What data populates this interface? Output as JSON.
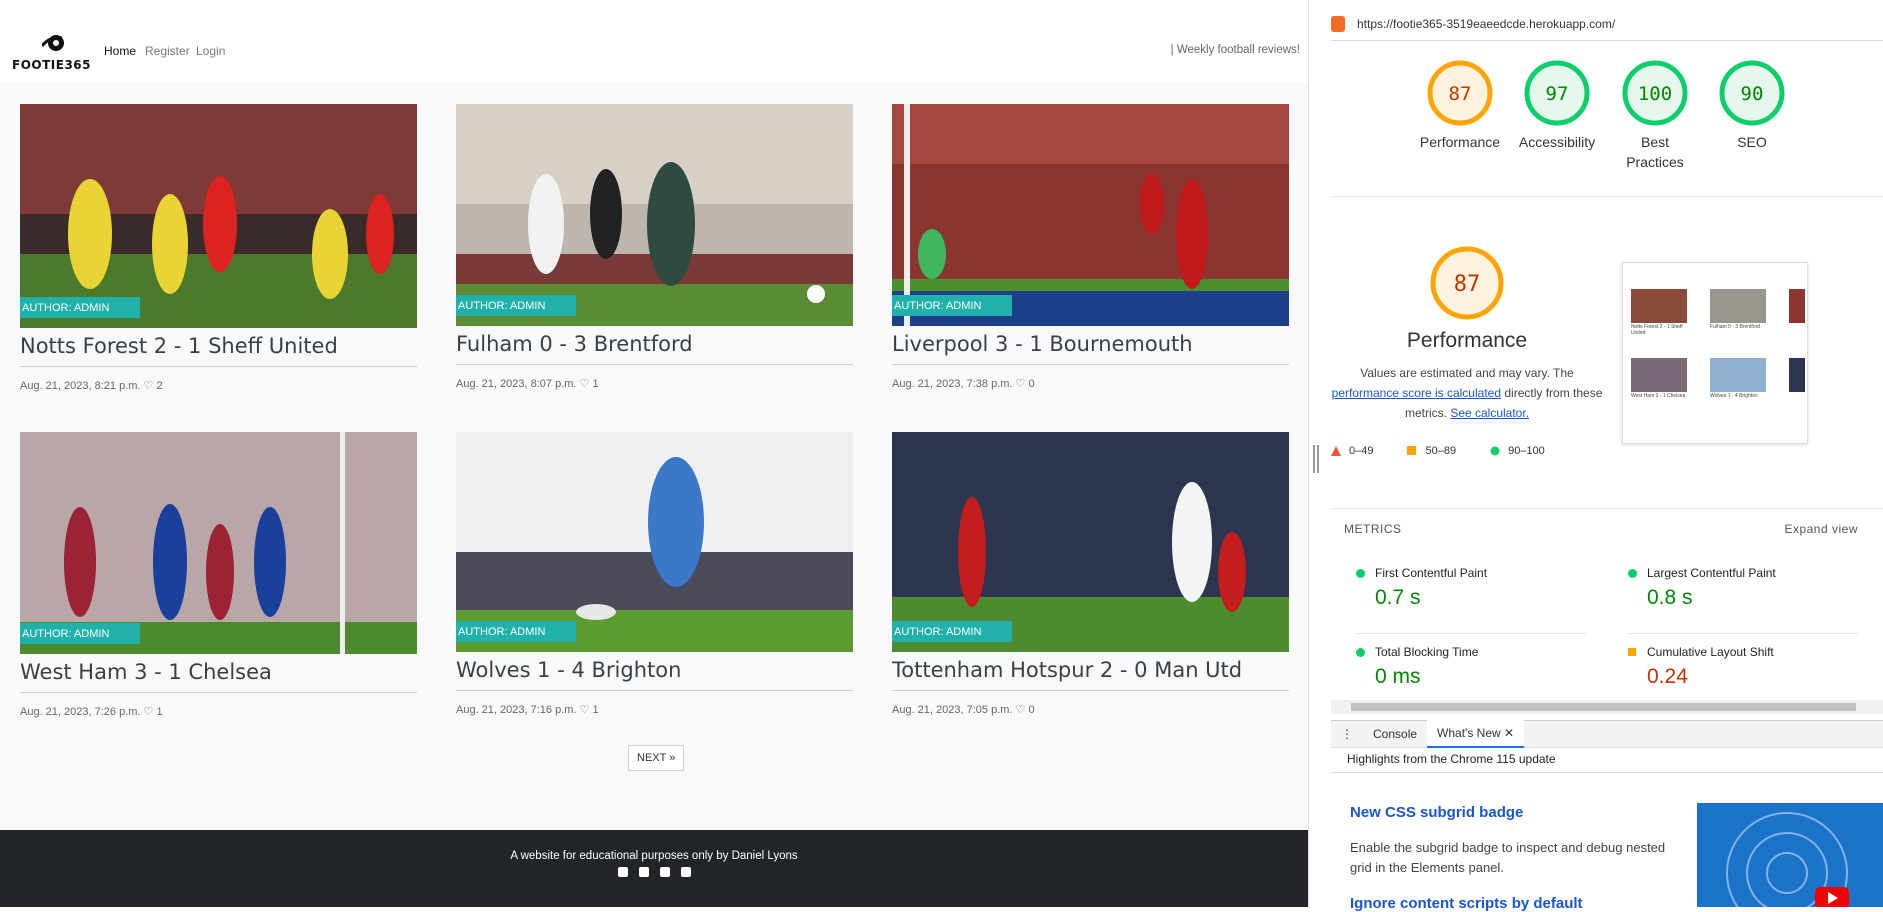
{
  "site": {
    "brand": "FOOTIE365",
    "nav": [
      "Home",
      "Register",
      "Login"
    ],
    "tagline": "| Weekly football reviews!",
    "next_label": "NEXT »",
    "footer_text": "A website for educational purposes only by Daniel Lyons",
    "footer_icons": [
      "facebook-icon",
      "twitter-icon",
      "instagram-icon",
      "youtube-icon"
    ],
    "posts": [
      {
        "author": "AUTHOR: ADMIN",
        "title": "Notts Forest 2 - 1 Sheff United",
        "meta": "Aug. 21, 2023, 8:21 p.m. ♡ 2"
      },
      {
        "author": "AUTHOR: ADMIN",
        "title": "Fulham 0 - 3 Brentford",
        "meta": "Aug. 21, 2023, 8:07 p.m. ♡ 1"
      },
      {
        "author": "AUTHOR: ADMIN",
        "title": "Liverpool 3 - 1 Bournemouth",
        "meta": "Aug. 21, 2023, 7:38 p.m. ♡ 0"
      },
      {
        "author": "AUTHOR: ADMIN",
        "title": "West Ham 3 - 1 Chelsea",
        "meta": "Aug. 21, 2023, 7:26 p.m. ♡ 1"
      },
      {
        "author": "AUTHOR: ADMIN",
        "title": "Wolves 1 - 4 Brighton",
        "meta": "Aug. 21, 2023, 7:16 p.m. ♡ 1"
      },
      {
        "author": "AUTHOR: ADMIN",
        "title": "Tottenham Hotspur 2 - 0 Man Utd",
        "meta": "Aug. 21, 2023, 7:05 p.m. ♡ 0"
      }
    ],
    "colors": {
      "badge": "#20b2aa",
      "footer": "#212529"
    }
  },
  "devtools": {
    "url": "https://footie365-3519eaeedcde.herokuapp.com/",
    "scores": [
      {
        "value": "87",
        "label": "Performance",
        "level": "average"
      },
      {
        "value": "97",
        "label": "Accessibility",
        "level": "pass"
      },
      {
        "value": "100",
        "label": "Best Practices",
        "level": "pass"
      },
      {
        "value": "90",
        "label": "SEO",
        "level": "pass"
      }
    ],
    "perf_score": "87",
    "perf_title": "Performance",
    "perf_desc_1": "Values are estimated and may vary. The",
    "perf_link": "performance score is calculated",
    "perf_desc_2": "directly from these metrics.",
    "perf_calc_link": "See calculator.",
    "legend": [
      "0–49",
      "50–89",
      "90–100"
    ],
    "metrics_label": "METRICS",
    "expand_label": "Expand view",
    "metrics": [
      {
        "name": "First Contentful Paint",
        "value": "0.7 s",
        "status": "pass"
      },
      {
        "name": "Largest Contentful Paint",
        "value": "0.8 s",
        "status": "pass"
      },
      {
        "name": "Total Blocking Time",
        "value": "0 ms",
        "status": "pass"
      },
      {
        "name": "Cumulative Layout Shift",
        "value": "0.24",
        "status": "average"
      }
    ],
    "drawer_tabs": [
      "Console",
      "What's New"
    ],
    "highlights": "Highlights from the Chrome 115 update",
    "article1_title": "New CSS subgrid badge",
    "article1_desc": "Enable the subgrid badge to inspect and debug nested grid in the Elements panel.",
    "article2_title": "Ignore content scripts by default",
    "thumb_titles": [
      "Notts Forest 2 - 1 Sheff United",
      "Fulham 0 - 3 Brentford",
      "Liverpool 3 - 1 Bournemouth",
      "West Ham 3 - 1 Chelsea",
      "Wolves 1 - 4 Brighton",
      "Tottenham Hotspur 2 - 0 Man Utd"
    ],
    "colors": {
      "pass": "#0cce6b",
      "average": "#ffa400",
      "fail": "#ff4e42",
      "link": "#1a55d4"
    }
  }
}
